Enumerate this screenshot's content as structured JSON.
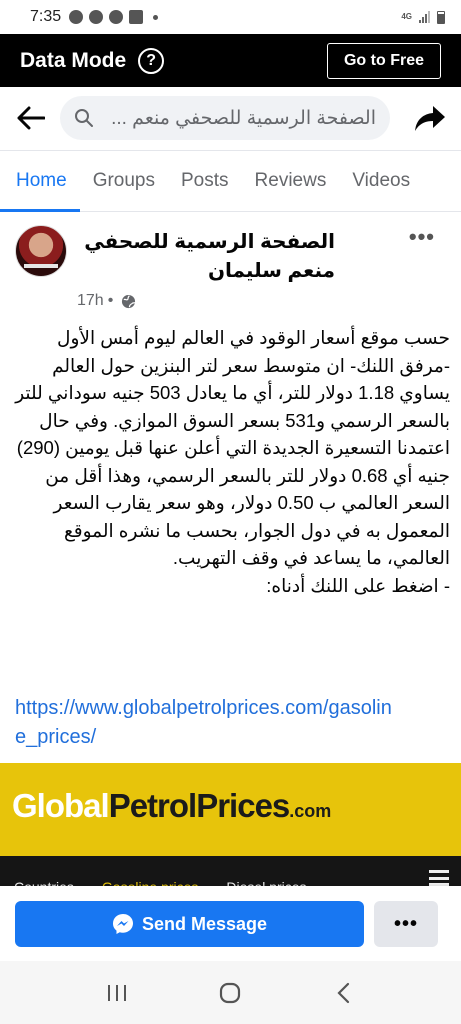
{
  "status_bar": {
    "time": "7:35",
    "network_label": "4G"
  },
  "data_mode_bar": {
    "title": "Data Mode",
    "help_symbol": "?",
    "go_free_label": "Go to Free"
  },
  "search": {
    "query": "الصفحة الرسمية للصحفي منعم ..."
  },
  "tabs": [
    {
      "label": "Home",
      "active": true
    },
    {
      "label": "Groups",
      "active": false
    },
    {
      "label": "Posts",
      "active": false
    },
    {
      "label": "Reviews",
      "active": false
    },
    {
      "label": "Videos",
      "active": false
    }
  ],
  "post": {
    "author": "الصفحة الرسمية للصحفي منعم سليمان",
    "time": "17h",
    "separator": "•",
    "more_symbol": "•••",
    "body": "حسب موقع أسعار الوقود في العالم ليوم أمس الأول -مرفق اللنك- ان متوسط سعر  لتر البنزين حول العالم يساوي 1.18 دولار للتر، أي ما يعادل 503 جنيه سوداني للتر بالسعر الرسمي و531 بسعر السوق الموازي. وفي حال اعتمدنا التسعيرة الجديدة التي أعلن عنها قبل يومين (290) جنيه أي 0.68 دولار للتر بالسعر الرسمي، وهذا أقل من السعر العالمي ب 0.50 دولار، وهو سعر يقارب السعر المعمول به في دول الجوار، بحسب  ما نشره الموقع العالمي، ما يساعد في وقف التهريب.",
    "cta": "- اضغط على اللنك أدناه:",
    "link": "https://www.globalpetrolprices.com/gasoline_prices/"
  },
  "link_preview": {
    "logo_part1": "Global",
    "logo_part2": "PetrolPrices",
    "logo_part3": ".com",
    "nav_items": [
      "Countries",
      "Gasoline prices",
      "Diesel prices"
    ],
    "active_nav": "Gasoline prices",
    "colors": {
      "background": "#e7c40b",
      "nav_background": "#151515"
    }
  },
  "actions": {
    "send_message_label": "Send Message",
    "more_symbol": "•••"
  },
  "colors": {
    "accent": "#1877f2",
    "link": "#216fdb",
    "muted": "#65676b"
  },
  "icons": [
    "back-arrow-icon",
    "search-icon",
    "share-icon",
    "globe-icon",
    "messenger-icon",
    "recents-icon",
    "home-circle-icon",
    "back-chevron-icon"
  ]
}
